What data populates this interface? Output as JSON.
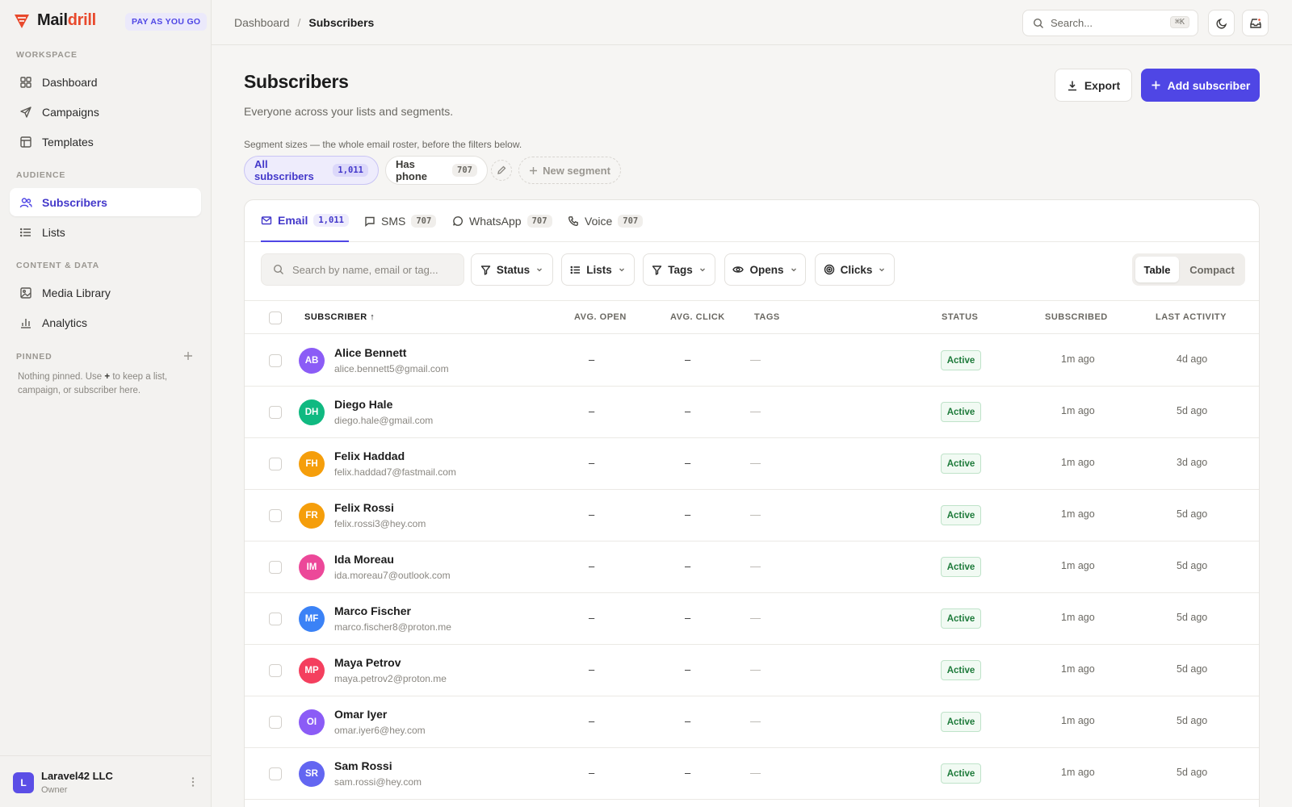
{
  "brand": {
    "name_part1": "Mail",
    "name_part2": "drill",
    "plan": "PAY AS YOU GO"
  },
  "sidebar": {
    "sections": [
      {
        "label": "WORKSPACE"
      },
      {
        "label": "AUDIENCE"
      },
      {
        "label": "CONTENT & DATA"
      },
      {
        "label": "PINNED"
      }
    ],
    "items": [
      {
        "label": "Dashboard",
        "icon": "grid-icon"
      },
      {
        "label": "Campaigns",
        "icon": "send-icon"
      },
      {
        "label": "Templates",
        "icon": "layout-icon"
      },
      {
        "label": "Subscribers",
        "icon": "users-icon",
        "active": true
      },
      {
        "label": "Lists",
        "icon": "list-icon"
      },
      {
        "label": "Media Library",
        "icon": "image-icon"
      },
      {
        "label": "Analytics",
        "icon": "bar-chart-icon"
      }
    ],
    "pinned_note_before": "Nothing pinned. Use ",
    "pinned_note_plus": "+",
    "pinned_note_after": " to keep a list, campaign, or subscriber here.",
    "org": {
      "initial": "L",
      "name": "Laravel42 LLC",
      "role": "Owner"
    }
  },
  "topbar": {
    "breadcrumb": [
      "Dashboard",
      "/",
      "Subscribers"
    ],
    "search_placeholder": "Search...",
    "search_shortcut": "⌘K"
  },
  "page": {
    "title": "Subscribers",
    "subtitle": "Everyone across your lists and segments.",
    "export_label": "Export",
    "add_label": "Add subscriber",
    "segment_note": "Segment sizes — the whole email roster, before the filters below.",
    "segments": [
      {
        "label": "All subscribers",
        "count": "1,011"
      },
      {
        "label": "Has phone",
        "count": "707"
      }
    ],
    "new_segment_label": "New segment"
  },
  "tabs": [
    {
      "label": "Email",
      "count": "1,011",
      "active": true
    },
    {
      "label": "SMS",
      "count": "707"
    },
    {
      "label": "WhatsApp",
      "count": "707"
    },
    {
      "label": "Voice",
      "count": "707"
    }
  ],
  "filters": {
    "search_placeholder": "Search by name, email or tag...",
    "buttons": [
      "Status",
      "Lists",
      "Tags",
      "Opens",
      "Clicks"
    ],
    "view_options": [
      "Table",
      "Compact"
    ],
    "active_view": "Table"
  },
  "table": {
    "columns": [
      "SUBSCRIBER ↑",
      "AVG. OPEN",
      "AVG. CLICK",
      "TAGS",
      "STATUS",
      "SUBSCRIBED",
      "LAST ACTIVITY"
    ],
    "rows": [
      {
        "initials": "AB",
        "name": "Alice Bennett",
        "email": "alice.bennett5@gmail.com",
        "avg_open": "–",
        "avg_click": "–",
        "tags": "—",
        "status": "Active",
        "subscribed": "1m ago",
        "last_activity": "4d ago",
        "color": "#8b5cf6"
      },
      {
        "initials": "DH",
        "name": "Diego Hale",
        "email": "diego.hale@gmail.com",
        "avg_open": "–",
        "avg_click": "–",
        "tags": "—",
        "status": "Active",
        "subscribed": "1m ago",
        "last_activity": "5d ago",
        "color": "#10b981"
      },
      {
        "initials": "FH",
        "name": "Felix Haddad",
        "email": "felix.haddad7@fastmail.com",
        "avg_open": "–",
        "avg_click": "–",
        "tags": "—",
        "status": "Active",
        "subscribed": "1m ago",
        "last_activity": "3d ago",
        "color": "#f59e0b"
      },
      {
        "initials": "FR",
        "name": "Felix Rossi",
        "email": "felix.rossi3@hey.com",
        "avg_open": "–",
        "avg_click": "–",
        "tags": "—",
        "status": "Active",
        "subscribed": "1m ago",
        "last_activity": "5d ago",
        "color": "#f59e0b"
      },
      {
        "initials": "IM",
        "name": "Ida Moreau",
        "email": "ida.moreau7@outlook.com",
        "avg_open": "–",
        "avg_click": "–",
        "tags": "—",
        "status": "Active",
        "subscribed": "1m ago",
        "last_activity": "5d ago",
        "color": "#ec4899"
      },
      {
        "initials": "MF",
        "name": "Marco Fischer",
        "email": "marco.fischer8@proton.me",
        "avg_open": "–",
        "avg_click": "–",
        "tags": "—",
        "status": "Active",
        "subscribed": "1m ago",
        "last_activity": "5d ago",
        "color": "#3b82f6"
      },
      {
        "initials": "MP",
        "name": "Maya Petrov",
        "email": "maya.petrov2@proton.me",
        "avg_open": "–",
        "avg_click": "–",
        "tags": "—",
        "status": "Active",
        "subscribed": "1m ago",
        "last_activity": "5d ago",
        "color": "#f43f5e"
      },
      {
        "initials": "OI",
        "name": "Omar Iyer",
        "email": "omar.iyer6@hey.com",
        "avg_open": "–",
        "avg_click": "–",
        "tags": "—",
        "status": "Active",
        "subscribed": "1m ago",
        "last_activity": "5d ago",
        "color": "#8b5cf6"
      },
      {
        "initials": "SR",
        "name": "Sam Rossi",
        "email": "sam.rossi@hey.com",
        "avg_open": "–",
        "avg_click": "–",
        "tags": "—",
        "status": "Active",
        "subscribed": "1m ago",
        "last_activity": "5d ago",
        "color": "#6366f1"
      }
    ]
  },
  "colors": {
    "accent": "#4f46e5",
    "brand": "#e8492c",
    "active_status": "#1d7a3a"
  }
}
